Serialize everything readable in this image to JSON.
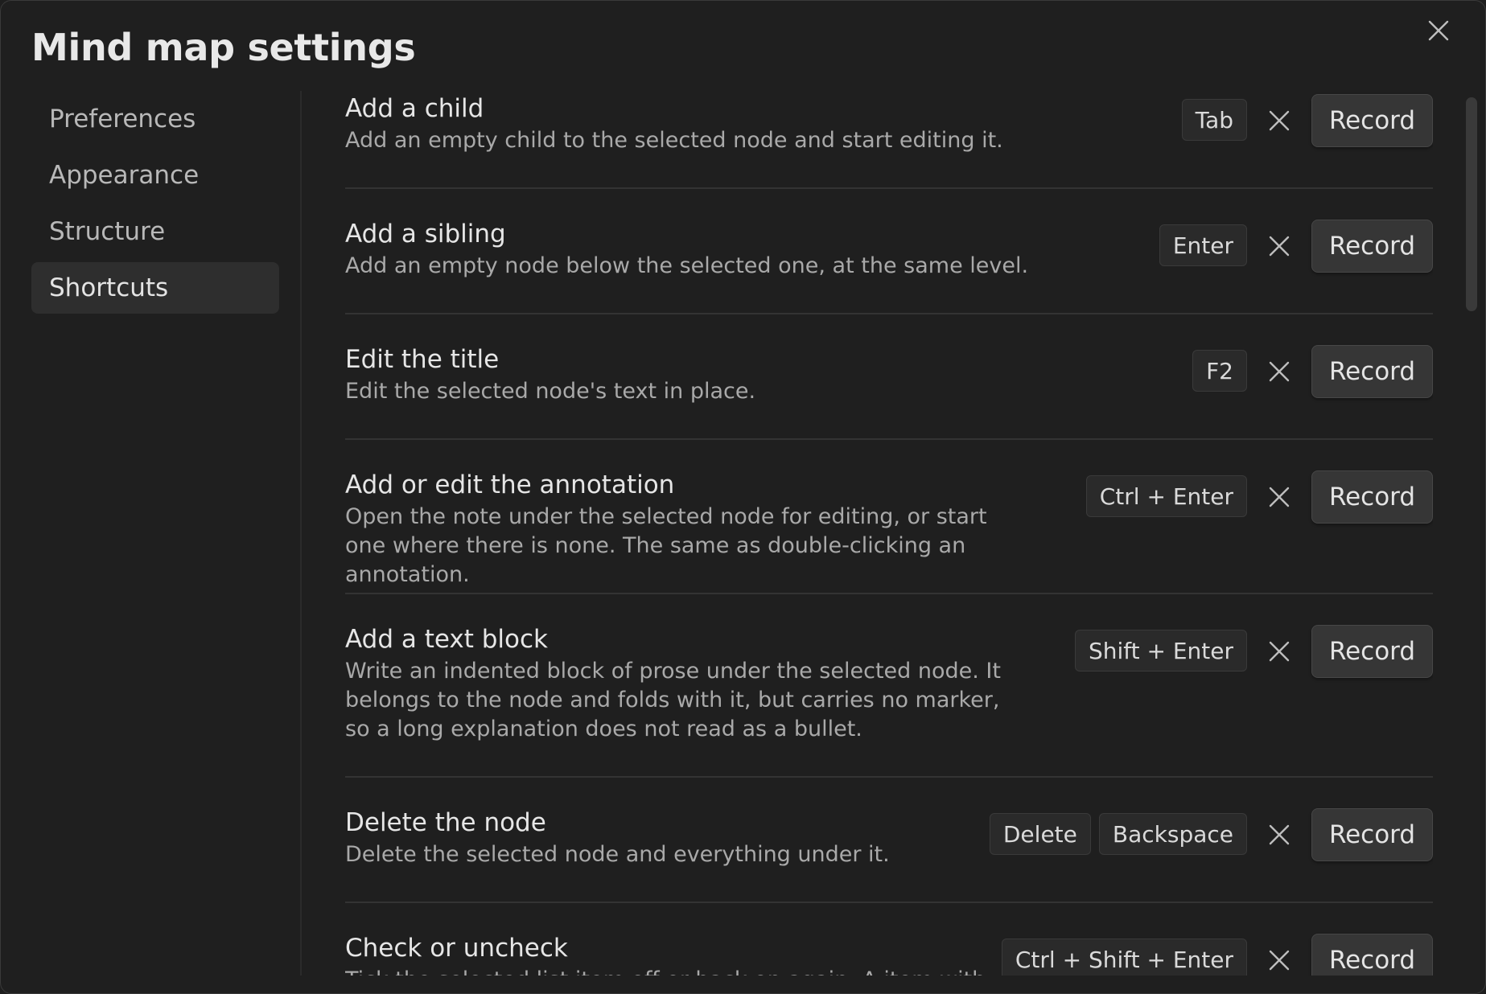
{
  "dialog": {
    "title": "Mind map settings"
  },
  "sidebar": {
    "items": [
      {
        "label": "Preferences",
        "active": false
      },
      {
        "label": "Appearance",
        "active": false
      },
      {
        "label": "Structure",
        "active": false
      },
      {
        "label": "Shortcuts",
        "active": true
      }
    ]
  },
  "shortcuts": {
    "record_label": "Record",
    "rows": [
      {
        "name": "Add a child",
        "desc": "Add an empty child to the selected node and start editing it.",
        "keys": [
          "Tab"
        ]
      },
      {
        "name": "Add a sibling",
        "desc": "Add an empty node below the selected one, at the same level.",
        "keys": [
          "Enter"
        ]
      },
      {
        "name": "Edit the title",
        "desc": "Edit the selected node's text in place.",
        "keys": [
          "F2"
        ]
      },
      {
        "name": "Add or edit the annotation",
        "desc": "Open the note under the selected node for editing, or start one where there is none. The same as double-clicking an annotation.",
        "keys": [
          "Ctrl + Enter"
        ]
      },
      {
        "name": "Add a text block",
        "desc": "Write an indented block of prose under the selected node. It belongs to the node and folds with it, but carries no marker, so a long explanation does not read as a bullet.",
        "keys": [
          "Shift + Enter"
        ]
      },
      {
        "name": "Delete the node",
        "desc": "Delete the selected node and everything under it.",
        "keys": [
          "Delete",
          "Backspace"
        ]
      },
      {
        "name": "Check or uncheck",
        "desc": "Tick the selected list item off or back on again. A item with",
        "keys": [
          "Ctrl + Shift + Enter"
        ]
      }
    ]
  },
  "icons": {
    "close": "close-icon",
    "clear": "x-icon"
  },
  "colors": {
    "background": "#1f1f1f",
    "active_nav": "#2e2e2e",
    "button": "#363636",
    "text": "#e6e6e6",
    "muted_text": "#a9a9a9"
  }
}
